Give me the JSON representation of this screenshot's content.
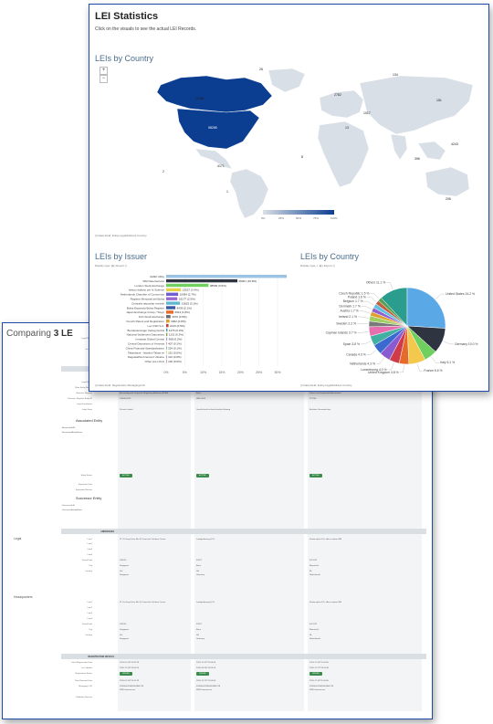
{
  "back": {
    "title_prefix": "Comparing ",
    "title_num": "3 LE",
    "header_labels": [
      "Legal Name",
      "Country"
    ],
    "entity_section": "ENTITY DETAILS",
    "entity_labels": [
      "LEI",
      "Legal Name",
      "Other Entity Names",
      "Business Register",
      "Business Register Entity ID",
      "Legal Jurisdiction",
      "Legal Form"
    ],
    "associated_group": "Associated Entity",
    "assoc_labels": [
      "- AssociatedLEI",
      "- AssociatedEntityName"
    ],
    "entity_status_label": "Entity Status",
    "expiration_labels": [
      "Expiration Date",
      "Expiration Reason"
    ],
    "successor_group": "Successor Entity",
    "succ_labels": [
      "- SuccessorLEI",
      "- SuccessorEntityName"
    ],
    "columns": [
      {
        "business_register": "Accounting and Corporate Regulatory Authority 'ACRA'",
        "register_id": "199604344Z",
        "legal_form": "Private Limited",
        "status": "ACTIVE",
        "address": "31 Tai Seng Drive 6th 06, Deutsche Telekom Centre",
        "postal": "535224",
        "city": "Singapore",
        "country": "SG",
        "country_name": "Singapore",
        "init_reg": "2014-01-10T14:37:29",
        "last_update": "2016-12-16T14:54:24",
        "reg_status": "ISSUED",
        "next_renewal": "2016-01-10T14:37:29",
        "managing_lou": "5299000J2N45DDNE5Y28",
        "managing_lou_sub": "WM Datenservice"
      },
      {
        "business_register": "Bonn",
        "register_id": "HRB 5669",
        "legal_form": "Gesellschaft mit beschränkter Haftung",
        "status": "ACTIVE",
        "address": "Landgrabenweg 151",
        "postal": "53227",
        "city": "Bonn",
        "country": "DE",
        "country_name": "Germany",
        "init_reg": "2013-12-12T12:04:06",
        "last_update": "2016-08-26T13:53:06",
        "reg_status": "ISSUED",
        "next_renewal": "2016-12-12T12:04:06",
        "managing_lou": "5299000J2N45DDNE5Y28",
        "managing_lou_sub": "WM Datenservice"
      },
      {
        "business_register": "Kamer van Koophandel Amsterdam",
        "register_id": "274765",
        "legal_form": "Besloten Vennootschap",
        "status": "ACTIVE",
        "address": "Stationsplein 8 K, office number 889",
        "postal": "4221 RT",
        "city": "Maastricht",
        "country": "NL",
        "country_name": "Netherlands",
        "init_reg": "2013-11-10T11:04:06",
        "last_update": "2016-11-27T19:24:46",
        "reg_status": "ISSUED",
        "next_renewal": "2016-11-10T11:04:06",
        "managing_lou": "5299000J2N45DDNE5Y28",
        "managing_lou_sub": "WM Datenservice"
      }
    ],
    "addresses_section": "ADDRESSES",
    "legal_group": "Legal",
    "hq_group": "Headquarters",
    "address_labels": [
      "Line1",
      "Line2",
      "Line3",
      "Line4",
      "PostalCode",
      "City",
      "Country"
    ],
    "registration_section": "REGISTRATION DETAILS",
    "reg_labels": [
      "Initial Registration Date",
      "Last Update",
      "Registration Status",
      "Next Renewal Date",
      "Managing LOU",
      "Validation Sources"
    ]
  },
  "front": {
    "title": "LEI Statistics",
    "subtitle": "Click on the visuals to see the actual LEI Records.",
    "map_section": "LEIs by Country",
    "zoom_in": "+",
    "zoom_out": "−",
    "map_legend_ticks": [
      "0%",
      "25%",
      "50%",
      "75%",
      "100%"
    ],
    "map_data_field": "(i) Data Field: Entity.LegalAddress.Country",
    "map_values": [
      "98285",
      "16381",
      "4171",
      "26",
      "2782",
      "134",
      "1017",
      "13",
      "151",
      "4243",
      "396",
      "206",
      "1",
      "2",
      "8"
    ],
    "issuer_section": "LEIs by Issuer",
    "issuer_toolbar": "Display type:  ▤  |  Export ⎙",
    "issuer_data_field": "(i) Data Field: Registration.ManagingLOU",
    "country_section": "LEIs by Country",
    "country_toolbar": "Display type:  ◐  ▤  |  Export ⎙",
    "country_data_field": "(i) Data Field: Entity.LegalAddress.Country"
  },
  "chart_data": [
    {
      "type": "bar",
      "title": "LEIs by Issuer",
      "orientation": "horizontal",
      "categories": [
        "GMEI Utility",
        "WM Datenservice",
        "London Stock Exchange",
        "Istituto Italiano per le Scienze",
        "Netherlands Chamber of Commerce",
        "Registre Mercantil del Bolsa",
        "Centralni depozitar vrednih",
        "Bolsa Espanola Bolsa Registre",
        "Japan Exchange Group / Tokyo",
        "Irish Stock Exchange",
        "French Patent and Registration",
        "Lux CSD S.A.",
        "Bundesanzeiger Verlag GmbH",
        "National Settlement Depository",
        "Inmarsat Global Central",
        "Central Depository of Armenia",
        "China Financial Standardization",
        "Takasbank - Istanbul Takas ve",
        "Dagsavkifta forencent Ukraine",
        "Other pre-LOUs"
      ],
      "values": [
        159189,
        65001,
        38599,
        13527,
        10934,
        10177,
        12625,
        8439,
        6644,
        3970,
        3062,
        2143,
        1176,
        1131,
        968,
        407,
        324,
        151,
        110,
        102
      ],
      "value_labels": [
        "159189 (39.5%)",
        "65001 (15.8%)",
        "38599 (9.5%)",
        "13527 (3.4%)",
        "10934 (2.7%)",
        "10177 (2.5%)",
        "12625 (3.1%)",
        "8439 (2.1%)",
        "6644 (1.6%)",
        "3970 (0.9%)",
        "3062 (0.8%)",
        "2143 (0.5%)",
        "1176 (0.3%)",
        "1131 (0.3%)",
        "968 (0.2%)",
        "407 (0.1%)",
        "324 (0.1%)",
        "151 (0.0%)",
        "110 (0.0%)",
        "102 (0.0%)"
      ],
      "colors": [
        "#9cc3e4",
        "#2e3440",
        "#6fcf5f",
        "#e6d24a",
        "#6f5fd0",
        "#9a6ad0",
        "#5fb8d0",
        "#3a5aa0",
        "#e66a2a",
        "#6a6a6a",
        "#e0a030",
        "#c04040",
        "#40a0a0",
        "#8aa04a",
        "#a0a0d0",
        "#d07090",
        "#30a070",
        "#c0c040",
        "#7070b0",
        "#a07050"
      ],
      "x_ticks": [
        "0%",
        "5%",
        "10%",
        "15%",
        "20%",
        "25%",
        "30%"
      ]
    },
    {
      "type": "pie",
      "title": "LEIs by Country",
      "labels": [
        "United States",
        "Germany",
        "Italy",
        "France",
        "United Kingdom",
        "Luxembourg",
        "Netherlands",
        "Canada",
        "Spain",
        "Cayman Islands",
        "Sweden",
        "Ireland",
        "Austria",
        "Denmark",
        "Belgium",
        "Poland",
        "Czech Republic",
        "Others"
      ],
      "values": [
        24.2,
        10.0,
        5.1,
        6.6,
        3.8,
        4.0,
        4.3,
        4.0,
        3.8,
        3.7,
        2.2,
        2.1,
        1.7,
        1.7,
        1.7,
        1.6,
        1.5,
        11.1
      ],
      "value_labels": [
        "United States 24.2 %",
        "Germany 10.0 %",
        "Italy 5.1 %",
        "France 6.6 %",
        "United Kingdom 3.8 %",
        "Luxembourg 4.0 %",
        "Netherlands 4.3 %",
        "Canada 4.0 %",
        "Spain 3.8 %",
        "Cayman Islands 3.7 %",
        "Sweden 2.2 %",
        "Ireland 2.1 %",
        "Austria 1.7 %",
        "Denmark 1.7 %",
        "Belgium 1.7 %",
        "Poland 1.6 %",
        "Czech Republic 1.5 %",
        "Others 11.1 %"
      ],
      "colors": [
        "#5aa9e6",
        "#2e3440",
        "#6fcf5f",
        "#f2c94c",
        "#e66a2a",
        "#d03b4a",
        "#8a5ad0",
        "#3a6ad0",
        "#40b0a0",
        "#e76fb0",
        "#7a7a7a",
        "#a0d060",
        "#e0a030",
        "#9060d0",
        "#60c0e0",
        "#c06040",
        "#50a050",
        "#2a9d8f"
      ]
    }
  ]
}
